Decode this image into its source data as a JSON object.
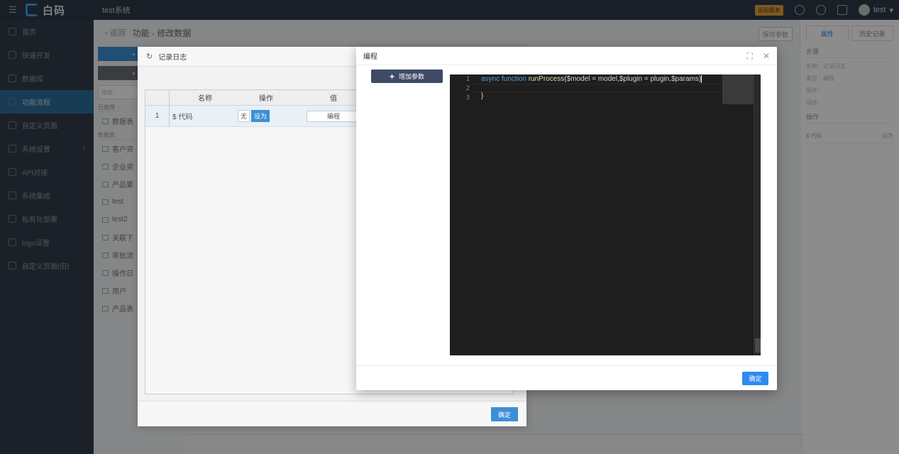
{
  "topbar": {
    "logo_text": "白码",
    "system_name": "test系统",
    "version_badge": "当前版本",
    "user_name": "test"
  },
  "sidebar": {
    "items": [
      {
        "label": "首页"
      },
      {
        "label": "快速开发"
      },
      {
        "label": "数据库"
      },
      {
        "label": "功能流程"
      },
      {
        "label": "自定义页面"
      },
      {
        "label": "系统设置"
      },
      {
        "label": "API对接"
      },
      {
        "label": "系统集成"
      },
      {
        "label": "私有化部署"
      },
      {
        "label": "logo设置"
      },
      {
        "label": "自定义页面(旧)"
      }
    ]
  },
  "content": {
    "back_label": "返回",
    "page_title": "功能 - 修改数据",
    "save_button": "保存参数",
    "left_tree": {
      "button_primary": "+ 单",
      "button_secondary": "+ 数",
      "search_placeholder": "搜索...",
      "group_used": "已使用",
      "group_data": "数据表",
      "used_items": [
        {
          "label": "数据表"
        }
      ],
      "items": [
        {
          "label": "客户资"
        },
        {
          "label": "企业资"
        },
        {
          "label": "产品要"
        },
        {
          "label": "test"
        },
        {
          "label": "test2"
        },
        {
          "label": "关联下"
        },
        {
          "label": "审批流"
        },
        {
          "label": "操作日"
        },
        {
          "label": "用户"
        },
        {
          "label": "产品表"
        }
      ]
    },
    "right_panel": {
      "tab_props": "属性",
      "tab_history": "历史记录",
      "section_steps": "步骤",
      "step_name": "名称：记录日志",
      "step_type": "类型：编程",
      "step_note1": "操作：",
      "step_note2": "描述：",
      "section_ops": "操作",
      "op_name": "$ 代码",
      "op_action": "设为"
    }
  },
  "bg_dialog": {
    "title": "记录日志",
    "columns": {
      "name": "名称",
      "op": "操作",
      "value": "值"
    },
    "rows": [
      {
        "index": "1",
        "name": "$ 代码",
        "op_none": "无",
        "op_set": "设为",
        "value_button": "编程"
      }
    ],
    "ok_button": "确定"
  },
  "modal": {
    "title": "编程",
    "add_param_button": "增加参数",
    "editor": {
      "line_numbers": [
        "1",
        "2",
        "3"
      ],
      "line1": {
        "kw_async": "async",
        "kw_function": "function",
        "fn_name": "runProcess",
        "params": "($model = model,$plugin = plugin,$params)"
      },
      "line2": "",
      "line3": "}"
    },
    "ok_button": "确定"
  }
}
